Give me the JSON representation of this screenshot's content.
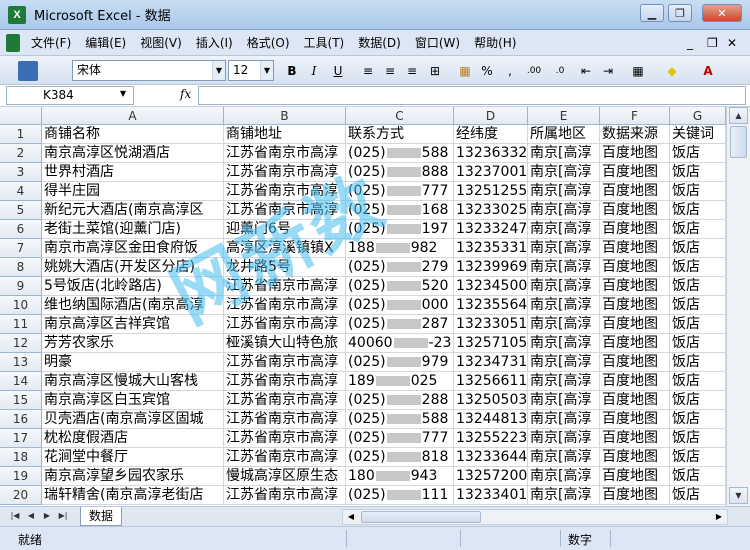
{
  "window": {
    "title": "Microsoft Excel - 数据",
    "app_icon": "X"
  },
  "menu": [
    "文件(F)",
    "编辑(E)",
    "视图(V)",
    "插入(I)",
    "格式(O)",
    "工具(T)",
    "数据(D)",
    "窗口(W)",
    "帮助(H)"
  ],
  "toolbar": {
    "font": "宋体",
    "size": "12"
  },
  "formula": {
    "namebox": "K384",
    "fx": "fx"
  },
  "columns": [
    "A",
    "B",
    "C",
    "D",
    "E",
    "F",
    "G"
  ],
  "rows": [
    {
      "n": "1",
      "a": "商铺名称",
      "b": "商铺地址",
      "c": "联系方式",
      "d": "经纬度",
      "e": "所属地区",
      "f": "数据来源",
      "g": "关键词"
    },
    {
      "n": "2",
      "a": "南京高淳区悦湖酒店",
      "b": "江苏省南京市高淳",
      "c": "(025)▒588",
      "d": "13236332.",
      "e": "南京[高淳",
      "f": "百度地图",
      "g": "饭店"
    },
    {
      "n": "3",
      "a": "世界村酒店",
      "b": "江苏省南京市高淳",
      "c": "(025)▒888",
      "d": "13237001.",
      "e": "南京[高淳",
      "f": "百度地图",
      "g": "饭店"
    },
    {
      "n": "4",
      "a": "得半庄园",
      "b": "江苏省南京市高淳",
      "c": "(025)▒777",
      "d": "13251255.",
      "e": "南京[高淳",
      "f": "百度地图",
      "g": "饭店"
    },
    {
      "n": "5",
      "a": "新纪元大酒店(南京高淳区",
      "b": "江苏省南京市高淳",
      "c": "(025)▒168",
      "d": "13233025.",
      "e": "南京[高淳",
      "f": "百度地图",
      "g": "饭店"
    },
    {
      "n": "6",
      "a": "老街土菜馆(迎薰门店)",
      "b": "迎薰门6号",
      "c": "(025)▒197",
      "d": "13233247.",
      "e": "南京[高淳",
      "f": "百度地图",
      "g": "饭店"
    },
    {
      "n": "7",
      "a": "南京市高淳区金田食府饭",
      "b": "高淳区淳溪镇镇X",
      "c": "188▒982",
      "d": "13235331.",
      "e": "南京[高淳",
      "f": "百度地图",
      "g": "饭店"
    },
    {
      "n": "8",
      "a": "姚姚大酒店(开发区分店)",
      "b": "龙井路5号",
      "c": "(025)▒279",
      "d": "13239969.",
      "e": "南京[高淳",
      "f": "百度地图",
      "g": "饭店"
    },
    {
      "n": "9",
      "a": "5号饭店(北岭路店)",
      "b": "江苏省南京市高淳",
      "c": "(025)▒520",
      "d": "13234500",
      "e": "南京[高淳",
      "f": "百度地图",
      "g": "饭店"
    },
    {
      "n": "10",
      "a": "维也纳国际酒店(南京高淳",
      "b": "江苏省南京市高淳",
      "c": "(025)▒000",
      "d": "13235564.",
      "e": "南京[高淳",
      "f": "百度地图",
      "g": "饭店"
    },
    {
      "n": "11",
      "a": "南京高淳区吉祥宾馆",
      "b": "江苏省南京市高淳",
      "c": "(025)▒287",
      "d": "13233051",
      "e": "南京[高淳",
      "f": "百度地图",
      "g": "饭店"
    },
    {
      "n": "12",
      "a": "芳芳农家乐",
      "b": "桠溪镇大山特色旅",
      "c": "40060▒-23",
      "d": "13257105.",
      "e": "南京[高淳",
      "f": "百度地图",
      "g": "饭店"
    },
    {
      "n": "13",
      "a": "明豪",
      "b": "江苏省南京市高淳",
      "c": "(025)▒979",
      "d": "13234731.",
      "e": "南京[高淳",
      "f": "百度地图",
      "g": "饭店"
    },
    {
      "n": "14",
      "a": "南京高淳区慢城大山客栈",
      "b": "江苏省南京市高淳",
      "c": "189▒025",
      "d": "13256611.",
      "e": "南京[高淳",
      "f": "百度地图",
      "g": "饭店"
    },
    {
      "n": "15",
      "a": "南京高淳区白玉宾馆",
      "b": "江苏省南京市高淳",
      "c": "(025)▒288",
      "d": "13250503.",
      "e": "南京[高淳",
      "f": "百度地图",
      "g": "饭店"
    },
    {
      "n": "16",
      "a": "贝壳酒店(南京高淳区固城",
      "b": "江苏省南京市高淳",
      "c": "(025)▒588",
      "d": "13244813.",
      "e": "南京[高淳",
      "f": "百度地图",
      "g": "饭店"
    },
    {
      "n": "17",
      "a": "枕松度假酒店",
      "b": "江苏省南京市高淳",
      "c": "(025)▒777",
      "d": "13255223.",
      "e": "南京[高淳",
      "f": "百度地图",
      "g": "饭店"
    },
    {
      "n": "18",
      "a": "花涧堂中餐厅",
      "b": "江苏省南京市高淳",
      "c": "(025)▒818",
      "d": "13233644.",
      "e": "南京[高淳",
      "f": "百度地图",
      "g": "饭店"
    },
    {
      "n": "19",
      "a": "南京高淳望乡园农家乐",
      "b": "慢城高淳区原生态",
      "c": "180▒943",
      "d": "13257200",
      "e": "南京[高淳",
      "f": "百度地图",
      "g": "饭店"
    },
    {
      "n": "20",
      "a": "瑞轩精舍(南京高淳老街店",
      "b": "江苏省南京市高淳",
      "c": "(025)▒111",
      "d": "13233401.",
      "e": "南京[高淳",
      "f": "百度地图",
      "g": "饭店"
    }
  ],
  "sheet_tab": "数据",
  "status": {
    "left": "就绪",
    "mid": "数字"
  },
  "watermark": "网新数",
  "colors": {
    "watermark": "#46bef0",
    "grid_header": "#e4eaf2",
    "title_bar": "#a9c8ea"
  }
}
